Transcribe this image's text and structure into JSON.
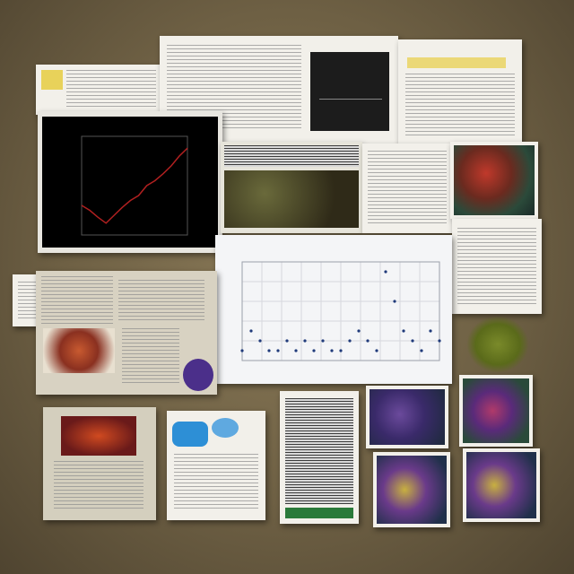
{
  "board": {
    "background": "#6e6044",
    "panels": [
      {
        "name": "top-left-doc"
      },
      {
        "name": "top-center-doc"
      },
      {
        "name": "top-right-doc"
      },
      {
        "name": "black-chart-panel"
      },
      {
        "name": "beetle-photo-strip"
      },
      {
        "name": "scatter-chart-panel"
      },
      {
        "name": "flower-photo"
      },
      {
        "name": "right-notes"
      },
      {
        "name": "left-notes"
      },
      {
        "name": "collage-left"
      },
      {
        "name": "bottom-photo-1"
      },
      {
        "name": "bottom-doc-blue"
      },
      {
        "name": "bottom-server-photo"
      },
      {
        "name": "bottom-photo-purple-1"
      },
      {
        "name": "bottom-photo-purple-2"
      },
      {
        "name": "bottom-photo-right-1"
      },
      {
        "name": "bottom-photo-right-2"
      }
    ]
  },
  "chart_data": [
    {
      "type": "line",
      "series": [
        {
          "values": [
            0.3,
            0.25,
            0.18,
            0.12,
            0.2,
            0.28,
            0.35,
            0.4,
            0.5,
            0.55,
            0.62,
            0.7,
            0.8,
            0.88
          ]
        }
      ],
      "background": "#000000",
      "line_color": "#b02020"
    },
    {
      "type": "scatter",
      "points": [
        [
          1,
          1
        ],
        [
          2,
          3
        ],
        [
          3,
          2
        ],
        [
          4,
          1
        ],
        [
          5,
          1
        ],
        [
          6,
          2
        ],
        [
          7,
          1
        ],
        [
          8,
          2
        ],
        [
          9,
          1
        ],
        [
          10,
          2
        ],
        [
          11,
          1
        ],
        [
          12,
          1
        ],
        [
          13,
          2
        ],
        [
          14,
          3
        ],
        [
          15,
          2
        ],
        [
          16,
          1
        ],
        [
          17,
          9
        ],
        [
          18,
          6
        ],
        [
          19,
          3
        ],
        [
          20,
          2
        ],
        [
          21,
          1
        ],
        [
          22,
          3
        ],
        [
          23,
          2
        ]
      ],
      "grid": true,
      "point_color": "#1f3a7a"
    }
  ]
}
